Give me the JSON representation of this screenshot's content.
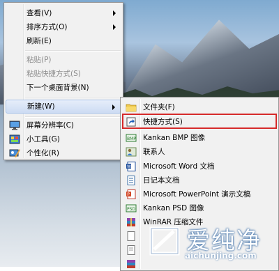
{
  "context_menu": {
    "items": [
      {
        "label": "查看(V)",
        "has_submenu": true
      },
      {
        "label": "排序方式(O)",
        "has_submenu": true
      },
      {
        "label": "刷新(E)"
      },
      {
        "label": "粘贴(P)",
        "disabled": true
      },
      {
        "label": "粘贴快捷方式(S)",
        "disabled": true
      },
      {
        "label": "下一个桌面背景(N)"
      },
      {
        "label": "新建(W)",
        "has_submenu": true,
        "highlighted": true
      },
      {
        "label": "屏幕分辨率(C)",
        "icon": "display-icon"
      },
      {
        "label": "小工具(G)",
        "icon": "gadgets-icon"
      },
      {
        "label": "个性化(R)",
        "icon": "personalize-icon"
      }
    ]
  },
  "new_submenu": {
    "items": [
      {
        "label": "文件夹(F)",
        "icon": "folder-icon"
      },
      {
        "label": "快捷方式(S)",
        "icon": "shortcut-icon",
        "highlighted": true
      },
      {
        "label": "Kankan BMP 图像",
        "icon": "bmp-image-icon"
      },
      {
        "label": "联系人",
        "icon": "contact-icon"
      },
      {
        "label": "Microsoft Word 文档",
        "icon": "word-document-icon"
      },
      {
        "label": "日记本文档",
        "icon": "journal-document-icon"
      },
      {
        "label": "Microsoft PowerPoint 演示文稿",
        "icon": "powerpoint-icon"
      },
      {
        "label": "Kankan PSD 图像",
        "icon": "psd-image-icon"
      },
      {
        "label": "WinRAR 压缩文件",
        "icon": "winrar-icon"
      }
    ]
  },
  "colors": {
    "highlight_box": "#d62a2a",
    "menu_background": "#f1f1f1"
  },
  "watermark": {
    "title": "爱纯净",
    "url": "aichunjing.com"
  }
}
